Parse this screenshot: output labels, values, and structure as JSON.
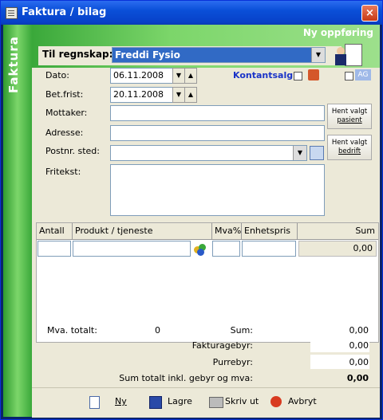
{
  "window": {
    "title": "Faktura / bilag",
    "close_label": "×"
  },
  "sidebar": {
    "label": "Faktura"
  },
  "header": {
    "mode_text": "Ny oppføring",
    "regnskap_label": "Til regnskap:",
    "regnskap_value": "Freddi Fysio"
  },
  "form": {
    "dato_label": "Dato:",
    "dato_value": "06.11.2008",
    "betfrist_label": "Bet.frist:",
    "betfrist_value": "20.11.2008",
    "kontantsalg_label": "Kontantsalg:",
    "mottaker_label": "Mottaker:",
    "mottaker_value": "",
    "adresse_label": "Adresse:",
    "adresse_value": "",
    "postnr_label": "Postnr. sted:",
    "postnr_value": "",
    "fritekst_label": "Fritekst:",
    "fritekst_value": "",
    "hent_pasient_label": "Hent valgt",
    "hent_pasient_label2": "pasient",
    "hent_bedrift_label": "Hent valgt",
    "hent_bedrift_label2": "bedrift",
    "ag_label": "AG"
  },
  "table": {
    "headers": [
      "Antall",
      "Produkt / tjeneste",
      "Mva%",
      "Enhetspris",
      "Sum"
    ],
    "row": {
      "antall": "",
      "produkt": "",
      "mva": "",
      "enhetspris": "",
      "sum": "0,00"
    }
  },
  "totals": {
    "mva_label": "Mva. totalt:",
    "mva_value": "0",
    "sum_label": "Sum:",
    "sum_value": "0,00",
    "fakturagebyr_label": "Fakturagebyr:",
    "fakturagebyr_value": "0,00",
    "purregebyr_label": "Purrebyr:",
    "purregebyr_value": "0,00",
    "total_label": "Sum totalt inkl. gebyr og mva:",
    "total_value": "0,00"
  },
  "footer": {
    "ny_label": "Ny",
    "lagre_label": "Lagre",
    "skriv_label": "Skriv ut",
    "avbryt_label": "Avbryt"
  },
  "colors": {
    "title_blue": "#0a4fd8",
    "green_bar": "#3aa83a",
    "kontant_blue": "#1a33c8"
  }
}
